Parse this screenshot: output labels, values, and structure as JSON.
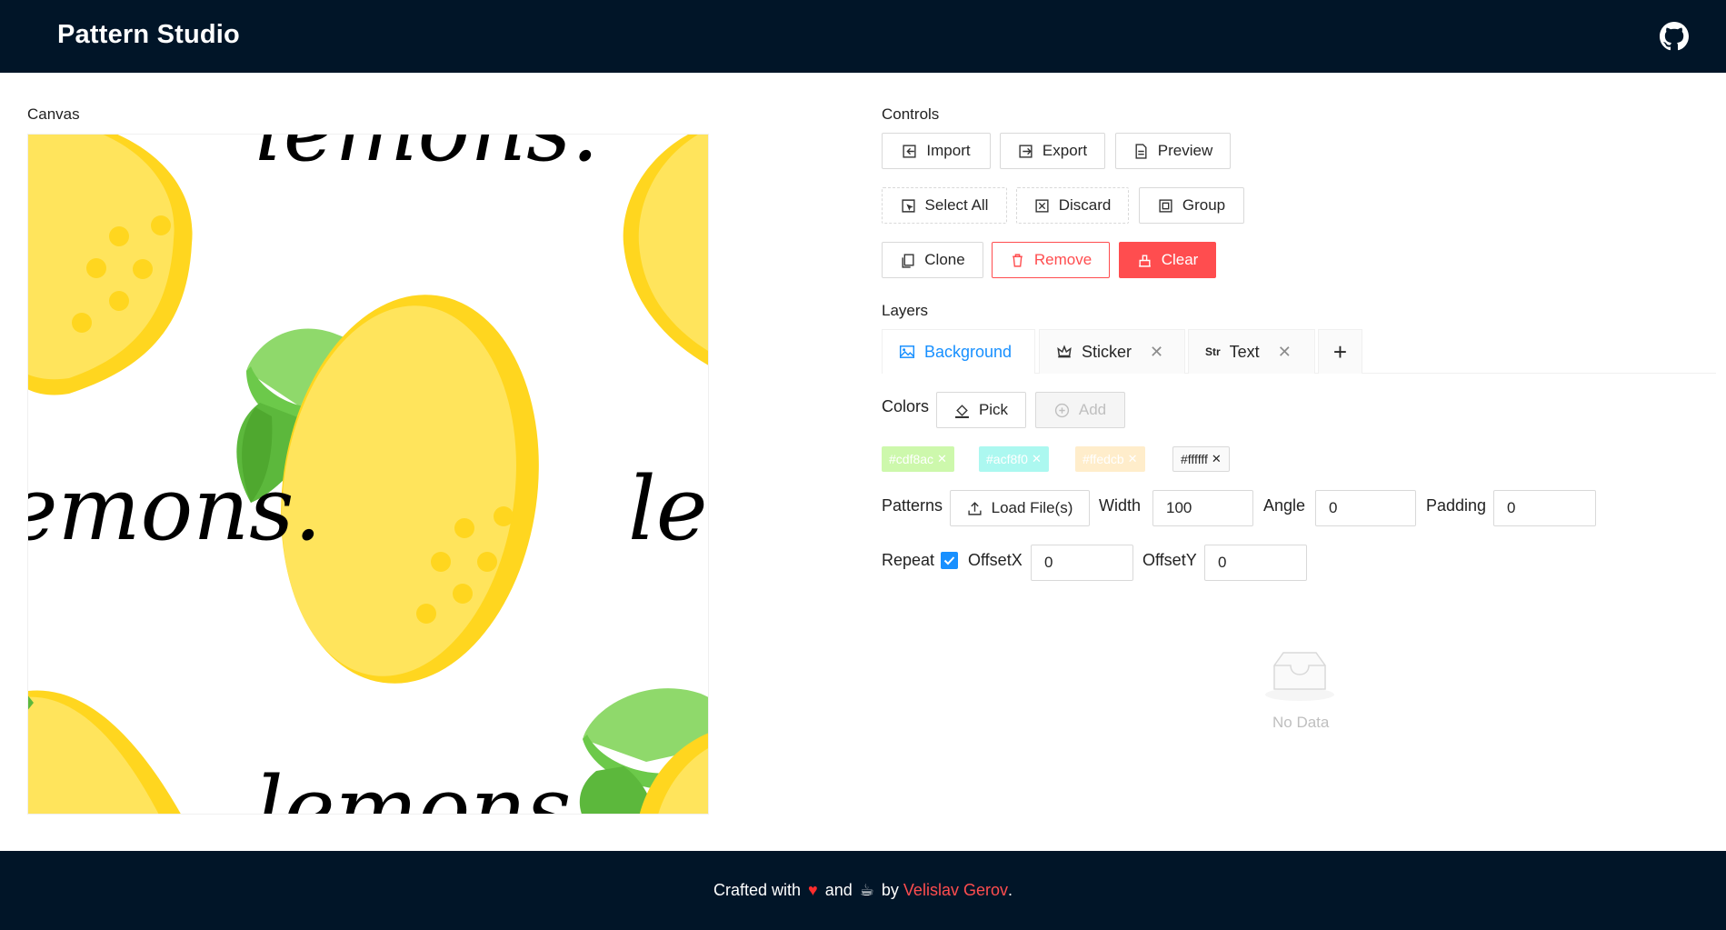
{
  "app": {
    "title": "Pattern Studio"
  },
  "canvas": {
    "label": "Canvas",
    "pattern_text": "lemons."
  },
  "controls": {
    "label": "Controls",
    "buttons": {
      "import": "Import",
      "export": "Export",
      "preview": "Preview",
      "select_all": "Select All",
      "discard": "Discard",
      "group": "Group",
      "clone": "Clone",
      "remove": "Remove",
      "clear": "Clear"
    }
  },
  "layers": {
    "label": "Layers",
    "tabs": [
      {
        "label": "Background"
      },
      {
        "label": "Sticker"
      },
      {
        "label": "Text",
        "icon_text": "Str"
      }
    ],
    "add_label": "+"
  },
  "colors": {
    "label": "Colors",
    "pick_label": "Pick",
    "add_label": "Add",
    "tags": [
      {
        "value": "#cdf8ac",
        "bg": "#cdf8ac"
      },
      {
        "value": "#acf8f0",
        "bg": "#acf8f0"
      },
      {
        "value": "#ffedcb",
        "bg": "#ffedcb"
      },
      {
        "value": "#ffffff",
        "bg": "#fafafa"
      }
    ]
  },
  "patterns": {
    "label": "Patterns",
    "load_label": "Load File(s)",
    "width_label": "Width",
    "width_value": "100",
    "angle_label": "Angle",
    "angle_value": "0",
    "padding_label": "Padding",
    "padding_value": "0",
    "repeat_label": "Repeat",
    "repeat_checked": true,
    "offsetx_label": "OffsetX",
    "offsetx_value": "0",
    "offsety_label": "OffsetY",
    "offsety_value": "0"
  },
  "empty": {
    "text": "No Data"
  },
  "footer": {
    "crafted": "Crafted with",
    "and": "and",
    "by": "by",
    "author": "Velislav Gerov",
    "period": "."
  },
  "colors_theme": {
    "header_bg": "#011528",
    "primary": "#1890ff",
    "danger": "#ff4d4f",
    "lemon": "#ffe45c",
    "lemon_dark": "#ffd61f",
    "leaf_light": "#8fd96b",
    "leaf_dark": "#5cb83c"
  }
}
